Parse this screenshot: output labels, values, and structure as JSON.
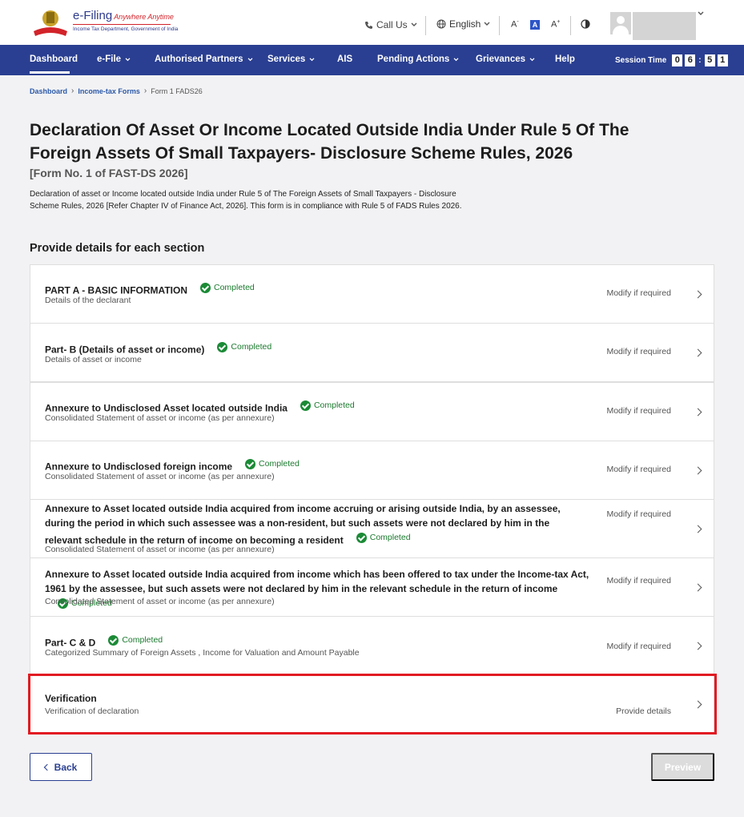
{
  "header": {
    "logo_title": "e-Filing",
    "logo_tagline": "Anywhere Anytime",
    "logo_subtitle": "Income Tax Department, Government of India",
    "call_us": "Call Us",
    "language": "English",
    "font_decrease": "A",
    "font_normal": "A",
    "font_increase": "A"
  },
  "nav": {
    "items": [
      {
        "label": "Dashboard"
      },
      {
        "label": "e-File"
      },
      {
        "label": "Authorised Partners"
      },
      {
        "label": "Services"
      },
      {
        "label": "AIS"
      },
      {
        "label": "Pending Actions"
      },
      {
        "label": "Grievances"
      },
      {
        "label": "Help"
      }
    ],
    "session_label": "Session Time",
    "session_digits": [
      "0",
      "6",
      "5",
      "1"
    ],
    "session_colon": ":"
  },
  "breadcrumb": {
    "items": [
      "Dashboard",
      "Income-tax Forms",
      "Form 1 FADS26"
    ],
    "separator": "›"
  },
  "page": {
    "title": "Declaration Of Asset Or Income Located Outside India Under Rule 5 Of The Foreign Assets Of Small Taxpayers- Disclosure Scheme Rules, 2026",
    "subtitle": "[Form No. 1 of FAST-DS 2026]",
    "description": "Declaration of asset or Income located outside India under Rule 5 of The Foreign Assets of Small Taxpayers - Disclosure Scheme Rules, 2026 [Refer Chapter IV of Finance Act, 2026]. This form is in compliance with Rule 5 of FADS Rules 2026.",
    "section_heading": "Provide details for each section"
  },
  "sections": [
    {
      "title": "PART A - BASIC INFORMATION",
      "status": "Completed",
      "subtitle": "Details of the declarant",
      "action": "Modify if required"
    },
    {
      "title": "Part- B (Details of asset or income)",
      "status": "Completed",
      "subtitle": "Details of asset or income",
      "action": "Modify if required"
    },
    {
      "title": "Annexure to Undisclosed Asset located outside India",
      "status": "Completed",
      "subtitle": "Consolidated Statement of asset or income (as per annexure)",
      "action": "Modify if required"
    },
    {
      "title": "Annexure to Undisclosed foreign income",
      "status": "Completed",
      "subtitle": "Consolidated Statement of asset or income (as per annexure)",
      "action": "Modify if required"
    },
    {
      "title": "Annexure to Asset located outside India acquired from income accruing or arising outside India, by an assessee, during the period in which such assessee was a non-resident, but such assets were not declared by him in the relevant schedule in the return of income on becoming a resident",
      "status": "Completed",
      "subtitle": "Consolidated Statement of asset or income (as per annexure)",
      "action": "Modify if required"
    },
    {
      "title": "Annexure to Asset located outside India acquired from income which has been offered to tax under the Income-tax Act, 1961 by the assessee, but such assets were not declared by him in the relevant schedule in the return of income",
      "status": "Completed",
      "subtitle": "Consolidated Statement of asset or income (as per annexure)",
      "action": "Modify if required"
    },
    {
      "title": "Part- C & D",
      "status": "Completed",
      "subtitle": "Categorized Summary of Foreign Assets , Income for Valuation and Amount Payable",
      "action": "Modify if required"
    },
    {
      "title": "Verification",
      "status": "",
      "subtitle": "Verification of declaration",
      "action": "Provide details"
    }
  ],
  "footer": {
    "back_label": "Back",
    "preview_label": "Preview"
  },
  "colors": {
    "nav_bg": "#2a3f91",
    "completed": "#1b7a2e",
    "highlight": "#e11b22"
  }
}
